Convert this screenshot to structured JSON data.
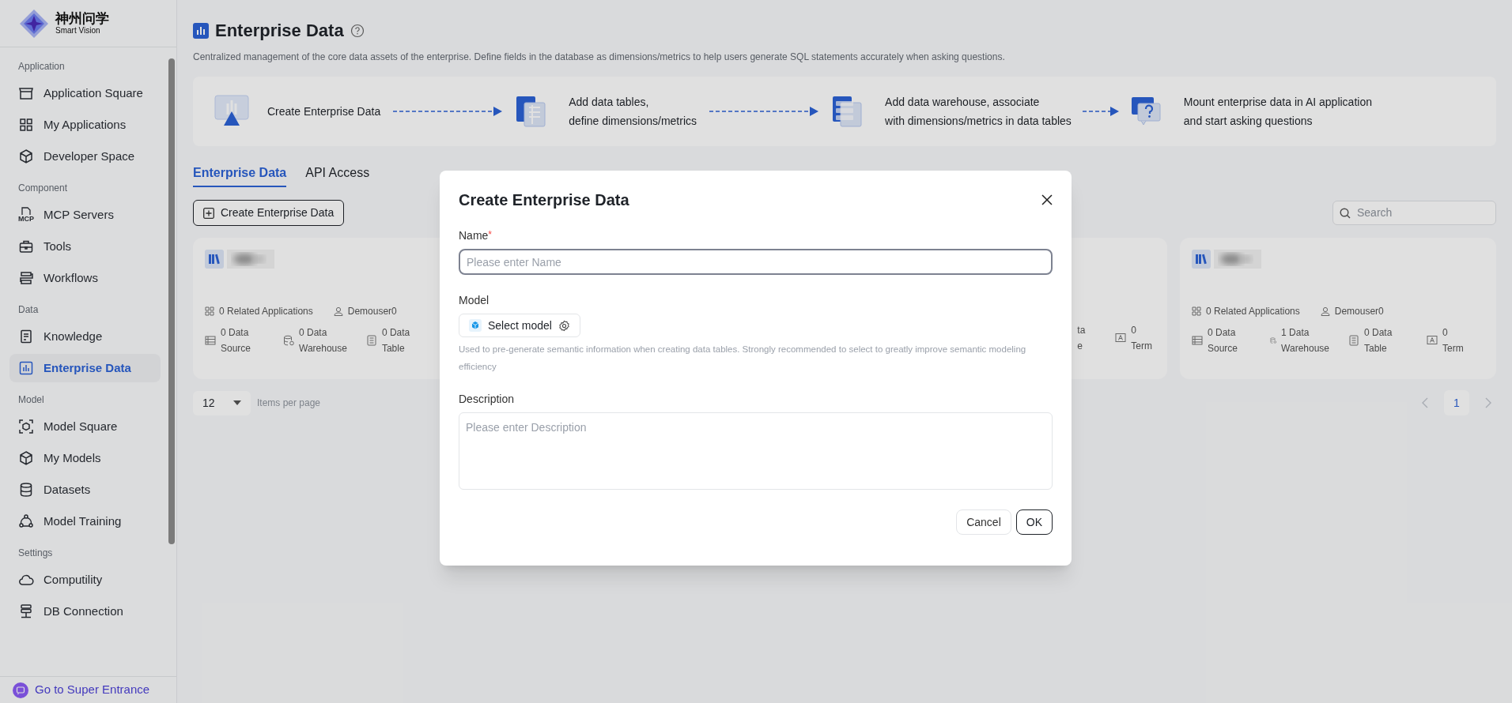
{
  "logo": {
    "title": "神州问学",
    "subtitle": "Smart Vision"
  },
  "sidebar": {
    "sections": [
      {
        "title": "Application",
        "items": [
          {
            "label": "Application Square",
            "kind": "store",
            "selected": false
          },
          {
            "label": "My Applications",
            "kind": "grid",
            "selected": false
          },
          {
            "label": "Developer Space",
            "kind": "hex",
            "selected": false
          }
        ]
      },
      {
        "title": "Component",
        "items": [
          {
            "label": "MCP Servers",
            "kind": "mcp",
            "icon_text": "MCP",
            "selected": false
          },
          {
            "label": "Tools",
            "kind": "toolbox",
            "selected": false
          },
          {
            "label": "Workflows",
            "kind": "flow",
            "selected": false
          }
        ]
      },
      {
        "title": "Data",
        "items": [
          {
            "label": "Knowledge",
            "kind": "doc",
            "selected": false
          },
          {
            "label": "Enterprise Data",
            "kind": "chart",
            "selected": true
          }
        ]
      },
      {
        "title": "Model",
        "items": [
          {
            "label": "Model Square",
            "kind": "scan",
            "selected": false
          },
          {
            "label": "My Models",
            "kind": "cube",
            "selected": false
          },
          {
            "label": "Datasets",
            "kind": "db",
            "selected": false
          },
          {
            "label": "Model Training",
            "kind": "nodes",
            "selected": false
          }
        ]
      },
      {
        "title": "Settings",
        "items": [
          {
            "label": "Computility",
            "kind": "cloud",
            "selected": false
          },
          {
            "label": "DB Connection",
            "kind": "server",
            "selected": false
          }
        ]
      }
    ],
    "footer": "Go to Super Entrance"
  },
  "page": {
    "title": "Enterprise Data",
    "description": "Centralized management of the core data assets of the enterprise. Define fields in the database as dimensions/metrics to help users generate SQL statements accurately when asking questions."
  },
  "steps": [
    {
      "kind": "create",
      "lines": [
        "Create Enterprise Data"
      ]
    },
    {
      "kind": "tables",
      "lines": [
        "Add data tables,",
        "define dimensions/metrics"
      ]
    },
    {
      "kind": "warehouse",
      "lines": [
        "Add data warehouse, associate",
        "with dimensions/metrics in data tables"
      ]
    },
    {
      "kind": "ask",
      "lines": [
        "Mount enterprise data in AI application",
        "and start asking questions"
      ]
    }
  ],
  "tabs": [
    {
      "label": "Enterprise Data",
      "selected": true
    },
    {
      "label": "API Access",
      "selected": false
    }
  ],
  "create_button": "Create Enterprise Data",
  "search": {
    "placeholder": "Search"
  },
  "cards": [
    {
      "related": "0 Related Applications",
      "owner": "Demouser0",
      "stats": [
        {
          "kind": "source",
          "lines": [
            "0 Data",
            "Source"
          ]
        },
        {
          "kind": "warehouse",
          "lines": [
            "0 Data",
            "Warehouse"
          ]
        },
        {
          "kind": "table",
          "lines": [
            "0 Data",
            "Table"
          ]
        }
      ]
    },
    {
      "stats": [
        {
          "lines": [
            "ta",
            "e"
          ]
        },
        {
          "kind": "term",
          "lines": [
            "0",
            "Term"
          ]
        }
      ]
    },
    {
      "related": "0 Related Applications",
      "owner": "Demouser0",
      "stats": [
        {
          "kind": "source",
          "lines": [
            "0 Data",
            "Source"
          ]
        },
        {
          "kind": "warehouse",
          "lines": [
            "1 Data",
            "Warehouse"
          ]
        },
        {
          "kind": "table",
          "lines": [
            "0 Data",
            "Table"
          ]
        },
        {
          "kind": "term",
          "lines": [
            "0",
            "Term"
          ]
        }
      ]
    }
  ],
  "pagination": {
    "page_size": "12",
    "page_size_label": "Items per page",
    "pages": [
      {
        "label": "1",
        "selected": true
      }
    ]
  },
  "dialog": {
    "title": "Create Enterprise Data",
    "name_label": "Name",
    "required_mark": "*",
    "name_placeholder": "Please enter Name",
    "model_label": "Model",
    "model_button": "Select model",
    "model_help": "Used to pre-generate semantic information when creating data tables. Strongly recommended to select to greatly improve semantic modeling efficiency",
    "description_label": "Description",
    "description_placeholder": "Please enter Description",
    "buttons": [
      {
        "label": "Cancel",
        "kind": "secondary"
      },
      {
        "label": "OK",
        "kind": "primary"
      }
    ]
  }
}
